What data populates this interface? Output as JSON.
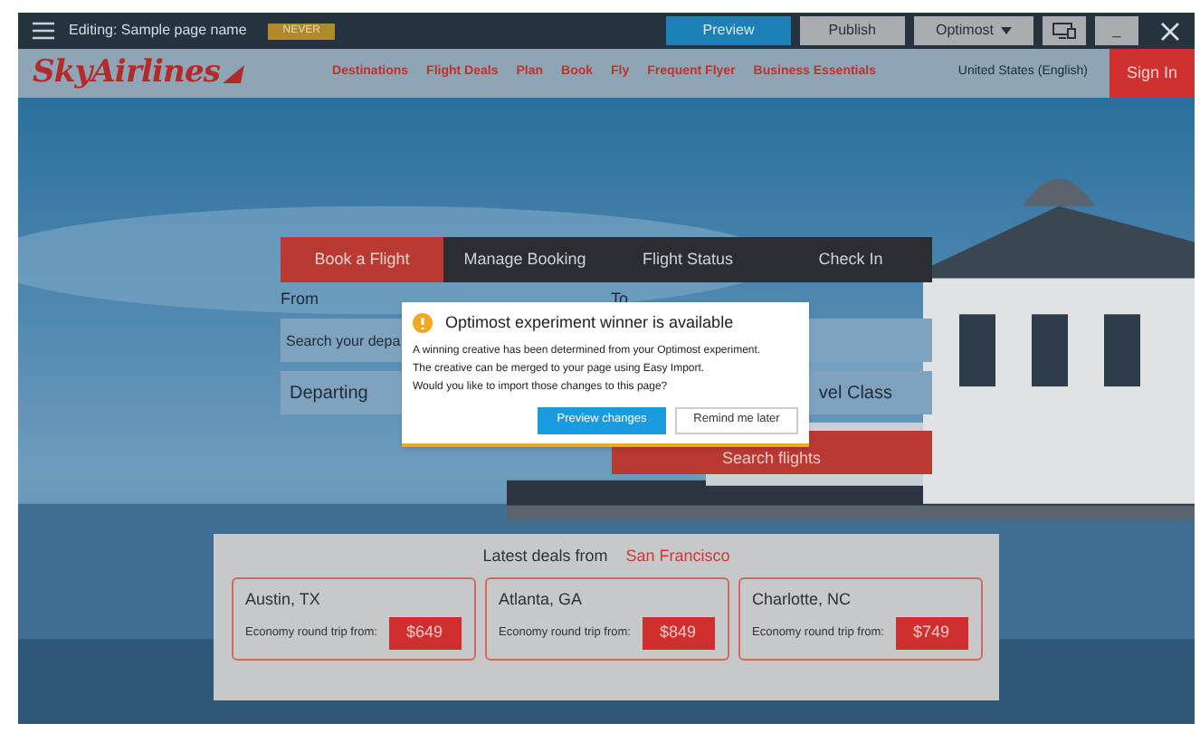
{
  "editor_bar": {
    "title": "Editing: Sample page name",
    "badge": "NEVER",
    "buttons": [
      {
        "kind": "primary",
        "label": "Preview"
      },
      {
        "kind": "secondary",
        "label": "Publish"
      },
      {
        "kind": "dropdown",
        "label": "Optimost"
      },
      {
        "kind": "device"
      },
      {
        "kind": "minimize",
        "label": "_"
      }
    ]
  },
  "nav": {
    "logo": "SkyAirlines",
    "links": [
      "Destinations",
      "Flight Deals",
      "Plan",
      "Book",
      "Fly",
      "Frequent Flyer",
      "Business Essentials"
    ],
    "locale": "United States (English)",
    "sign_in": "Sign In"
  },
  "booking": {
    "tabs": [
      {
        "label": "Book a Flight",
        "selected": true
      },
      {
        "label": "Manage Booking",
        "selected": false
      },
      {
        "label": "Flight Status",
        "selected": false
      },
      {
        "label": "Check In",
        "selected": false
      }
    ],
    "from_label": "From",
    "to_label": "To",
    "from_field": {
      "placeholder": "Search your depa"
    },
    "depart_field": {
      "placeholder": "Departing"
    },
    "class_field": {
      "placeholder": "vel Class"
    },
    "search_button": "Search flights"
  },
  "dialog": {
    "title": "Optimost experiment winner is available",
    "lines": [
      "A winning creative has been determined from your Optimost experiment.",
      "The creative can be merged to your page using Easy Import.",
      "Would you like to import those changes to this page?"
    ],
    "buttons": [
      {
        "kind": "primary",
        "label": "Preview changes"
      },
      {
        "kind": "secondary",
        "label": "Remind me later"
      }
    ]
  },
  "deals": {
    "heading": "Latest deals from",
    "city": "San Francisco",
    "cards": [
      {
        "city": "Austin, TX",
        "label": "Economy round trip from:",
        "price": "$649"
      },
      {
        "city": "Atlanta, GA",
        "label": "Economy round trip from:",
        "price": "$849"
      },
      {
        "city": "Charlotte, NC",
        "label": "Economy round trip from:",
        "price": "$749"
      }
    ]
  }
}
